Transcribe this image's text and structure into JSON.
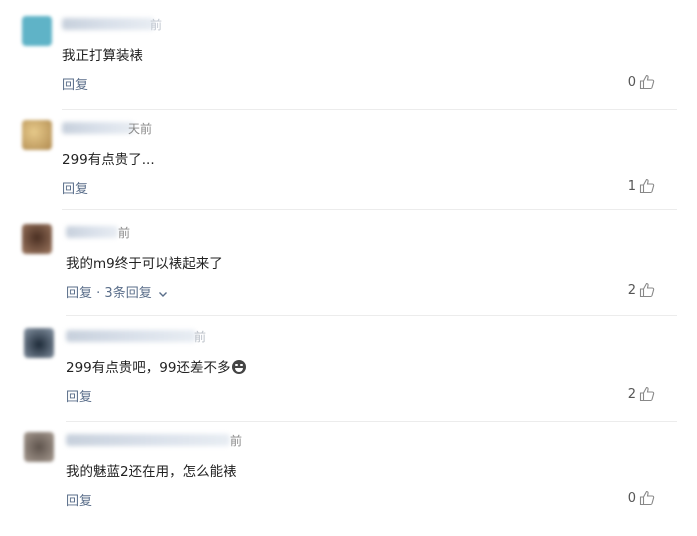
{
  "comments": [
    {
      "time_suffix": "前",
      "text": "我正打算装裱",
      "reply_label": "回复",
      "reply_count_label": "",
      "likes": "0",
      "avatar_color": "#5fb3c7"
    },
    {
      "time_suffix": "天前",
      "text": "299有点贵了...",
      "reply_label": "回复",
      "reply_count_label": "",
      "likes": "1",
      "avatar_color": "#c8a46a"
    },
    {
      "time_suffix": "前",
      "text": "我的m9终于可以裱起来了",
      "reply_label": "回复",
      "reply_count_label": "· 3条回复",
      "likes": "2",
      "avatar_color": "#6b4a36"
    },
    {
      "time_suffix": "前",
      "text": "299有点贵吧，99还差不多",
      "reply_label": "回复",
      "reply_count_label": "",
      "likes": "2",
      "avatar_color": "#2f3f52"
    },
    {
      "time_suffix": "前",
      "text": "我的魅蓝2还在用，怎么能裱",
      "reply_label": "回复",
      "reply_count_label": "",
      "likes": "0",
      "avatar_color": "#7a6e66"
    }
  ],
  "icons": {
    "like": "thumbs-up-icon",
    "expand": "chevron-down-icon",
    "emoji": "grin-emoji-icon"
  }
}
